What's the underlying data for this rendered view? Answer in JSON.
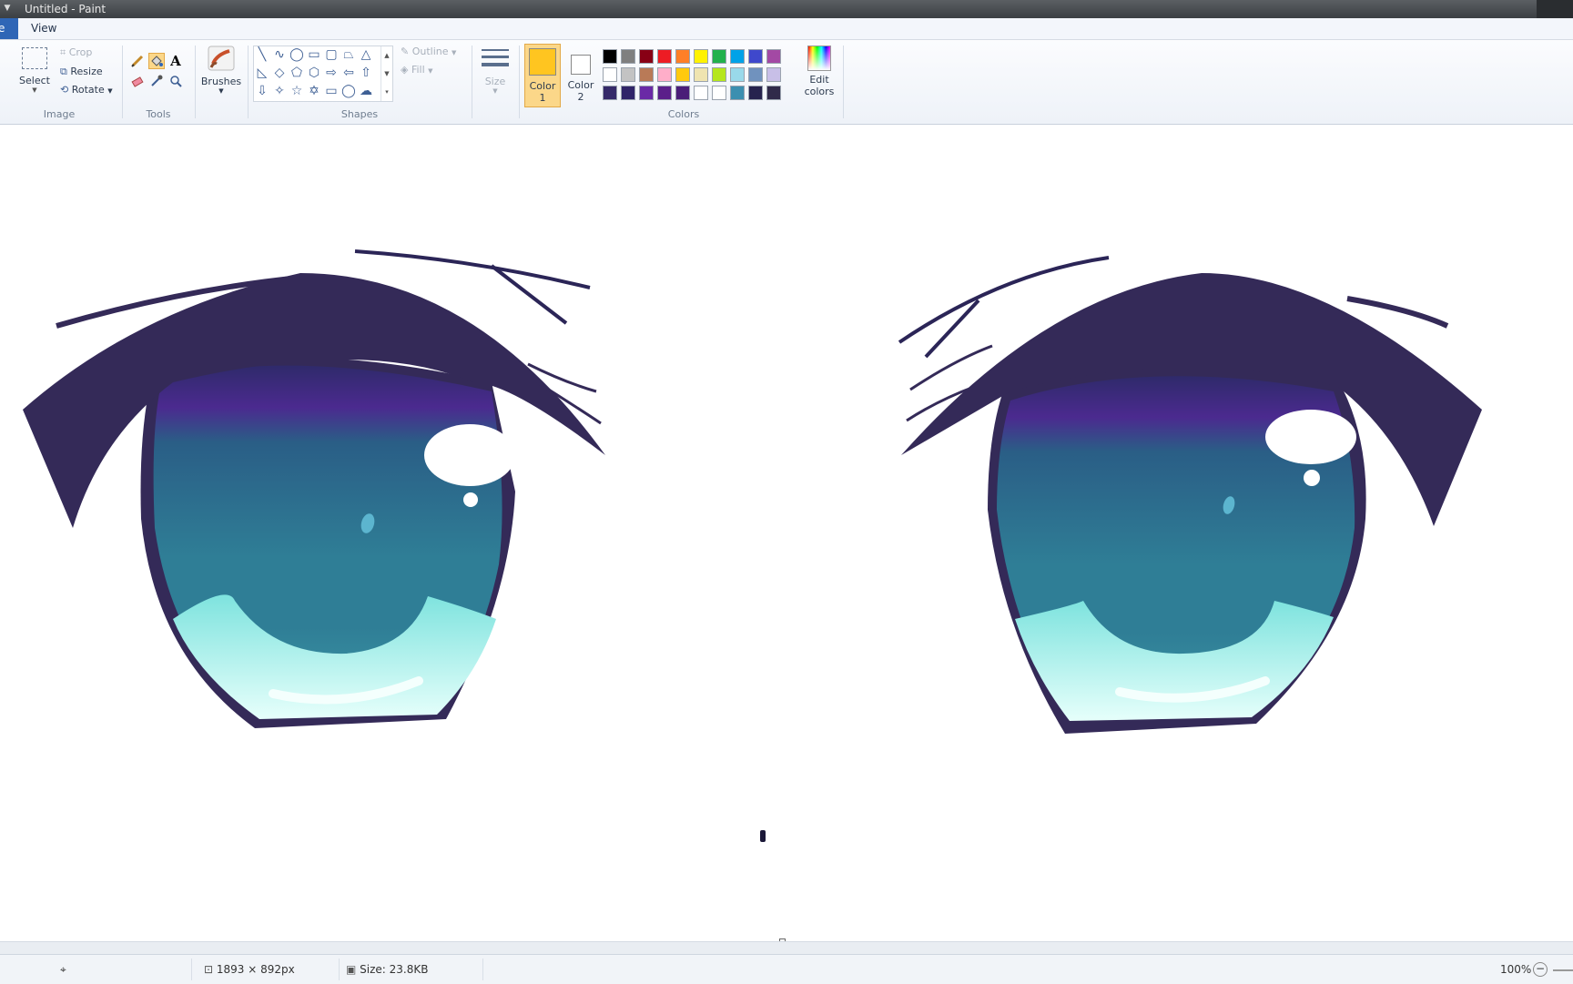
{
  "window": {
    "title": "Untitled - Paint"
  },
  "tabs": {
    "file": "e",
    "view": "View"
  },
  "ribbon": {
    "image_group": {
      "label": "Image",
      "select": "Select",
      "crop": "Crop",
      "resize": "Resize",
      "rotate": "Rotate"
    },
    "tools_group": {
      "label": "Tools"
    },
    "brushes": "Brushes",
    "shapes_group": {
      "label": "Shapes",
      "outline": "Outline",
      "fill": "Fill"
    },
    "size": "Size",
    "color1": {
      "label": "Color",
      "num": "1",
      "value": "#ffc520"
    },
    "color2": {
      "label": "Color",
      "num": "2",
      "value": "#ffffff"
    },
    "colors_group": {
      "label": "Colors"
    },
    "edit_colors_line1": "Edit",
    "edit_colors_line2": "colors",
    "palette": [
      [
        "#000000",
        "#7f7f7f",
        "#880015",
        "#ed1c24",
        "#ff7f27",
        "#fff200",
        "#22b14c",
        "#00a2e8",
        "#3f48cc",
        "#a349a4"
      ],
      [
        "#ffffff",
        "#c3c3c3",
        "#b97a57",
        "#ffaec9",
        "#ffc90e",
        "#efe4b0",
        "#b5e61d",
        "#99d9ea",
        "#7092be",
        "#c8bfe7"
      ],
      [
        "#352a69",
        "#2f2468",
        "#6a2aa6",
        "#5b1f8a",
        "#4a1e78",
        "#ffffff",
        "#ffffff",
        "#3b8fb0",
        "#26234e",
        "#302a4a"
      ]
    ]
  },
  "status": {
    "dimensions": "1893 × 892px",
    "size": "Size: 23.8KB",
    "zoom": "100%"
  }
}
